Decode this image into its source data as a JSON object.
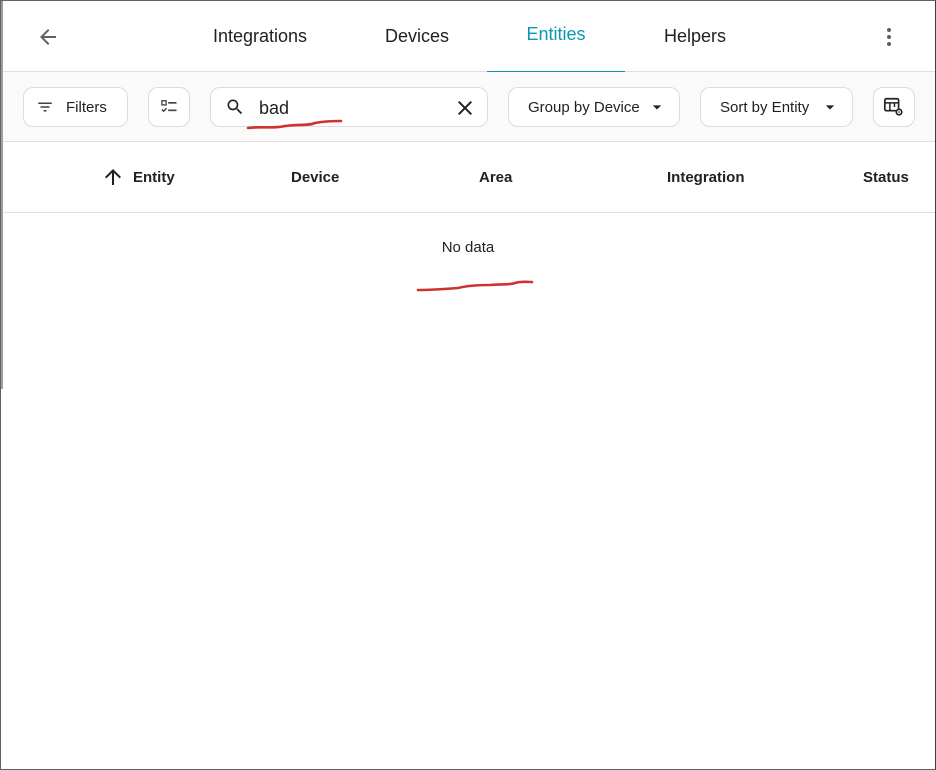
{
  "nav": {
    "back_icon": "arrow-left-icon",
    "tabs": [
      {
        "label": "Integrations",
        "active": false
      },
      {
        "label": "Devices",
        "active": false
      },
      {
        "label": "Entities",
        "active": true
      },
      {
        "label": "Helpers",
        "active": false
      }
    ],
    "menu_icon": "dots-vertical-icon",
    "accent_color": "#0b97b3"
  },
  "toolbar": {
    "filters_label": "Filters",
    "selection_icon": "format-list-checks-icon",
    "search": {
      "value": "bad",
      "placeholder": ""
    },
    "group_by_label": "Group by Device",
    "sort_by_label": "Sort by Entity",
    "table_settings_icon": "table-cog-icon"
  },
  "table": {
    "columns": [
      "Entity",
      "Device",
      "Area",
      "Integration",
      "Status"
    ],
    "sort_column": "Entity",
    "sort_direction": "ascending",
    "empty_text": "No data"
  },
  "annotations": {
    "color": "#d32f2f"
  }
}
